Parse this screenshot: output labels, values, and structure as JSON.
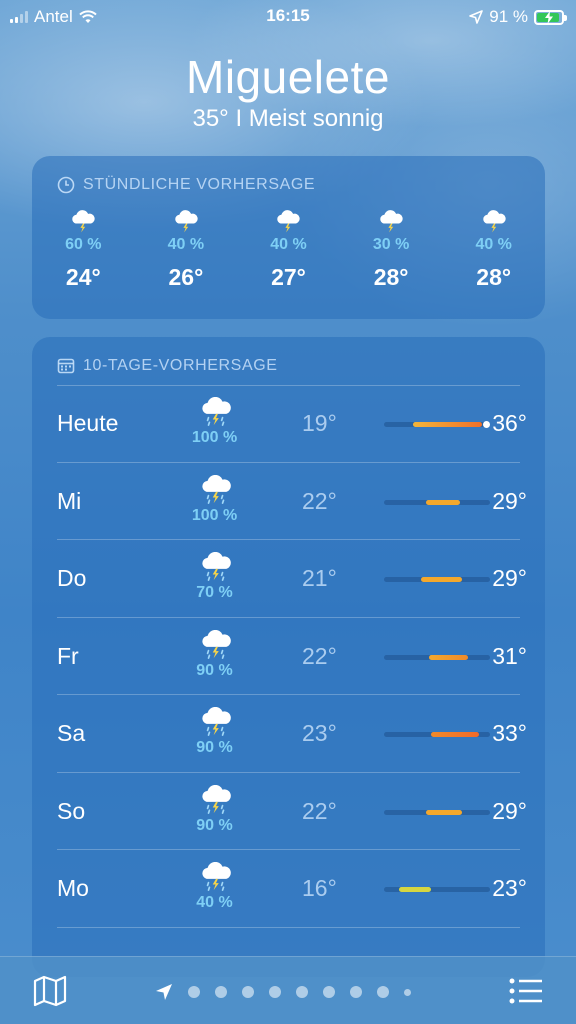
{
  "status_bar": {
    "carrier": "Antel",
    "time": "16:15",
    "battery": "91 %"
  },
  "header": {
    "city": "Miguelete",
    "summary": "35°  I  Meist sonnig"
  },
  "hourly": {
    "title": "STÜNDLICHE VORHERSAGE",
    "items": [
      {
        "pop": "60 %",
        "temp": "24°",
        "icon": "thunderstorm-icon"
      },
      {
        "pop": "40 %",
        "temp": "26°",
        "icon": "thunderstorm-icon"
      },
      {
        "pop": "40 %",
        "temp": "27°",
        "icon": "thunderstorm-icon"
      },
      {
        "pop": "30 %",
        "temp": "28°",
        "icon": "thunderstorm-icon"
      },
      {
        "pop": "40 %",
        "temp": "28°",
        "icon": "thunderstorm-icon"
      }
    ]
  },
  "daily": {
    "title": "10-TAGE-VORHERSAGE",
    "days": [
      {
        "name": "Heute",
        "pop": "100 %",
        "low": "19°",
        "high": "36°",
        "range": [
          0.27,
          0.92
        ],
        "colors": [
          "#f4b63a",
          "#f0702a"
        ],
        "current": 0.96,
        "icon": "thunderstorm-rain-icon"
      },
      {
        "name": "Mi",
        "pop": "100 %",
        "low": "22°",
        "high": "29°",
        "range": [
          0.4,
          0.72
        ],
        "colors": [
          "#f4a82c",
          "#f4a82c"
        ],
        "icon": "thunderstorm-rain-icon"
      },
      {
        "name": "Do",
        "pop": "70 %",
        "low": "21°",
        "high": "29°",
        "range": [
          0.35,
          0.74
        ],
        "colors": [
          "#f4a82c",
          "#f4a82c"
        ],
        "icon": "thunderstorm-rain-icon"
      },
      {
        "name": "Fr",
        "pop": "90 %",
        "low": "22°",
        "high": "31°",
        "range": [
          0.42,
          0.79
        ],
        "colors": [
          "#f4a82c",
          "#f08a2a"
        ],
        "icon": "thunderstorm-rain-icon"
      },
      {
        "name": "Sa",
        "pop": "90 %",
        "low": "23°",
        "high": "33°",
        "range": [
          0.44,
          0.9
        ],
        "colors": [
          "#f08a2a",
          "#f06a2a"
        ],
        "icon": "thunderstorm-rain-icon"
      },
      {
        "name": "So",
        "pop": "90 %",
        "low": "22°",
        "high": "29°",
        "range": [
          0.4,
          0.74
        ],
        "colors": [
          "#f4a82c",
          "#f4a82c"
        ],
        "icon": "thunderstorm-rain-icon"
      },
      {
        "name": "Mo",
        "pop": "40 %",
        "low": "16°",
        "high": "23°",
        "range": [
          0.14,
          0.44
        ],
        "colors": [
          "#d6d640",
          "#d6d640"
        ],
        "icon": "thunderstorm-rain-icon"
      }
    ]
  },
  "bottom_bar": {
    "map_icon": "map-icon",
    "list_icon": "list-icon",
    "page_count": 9
  }
}
